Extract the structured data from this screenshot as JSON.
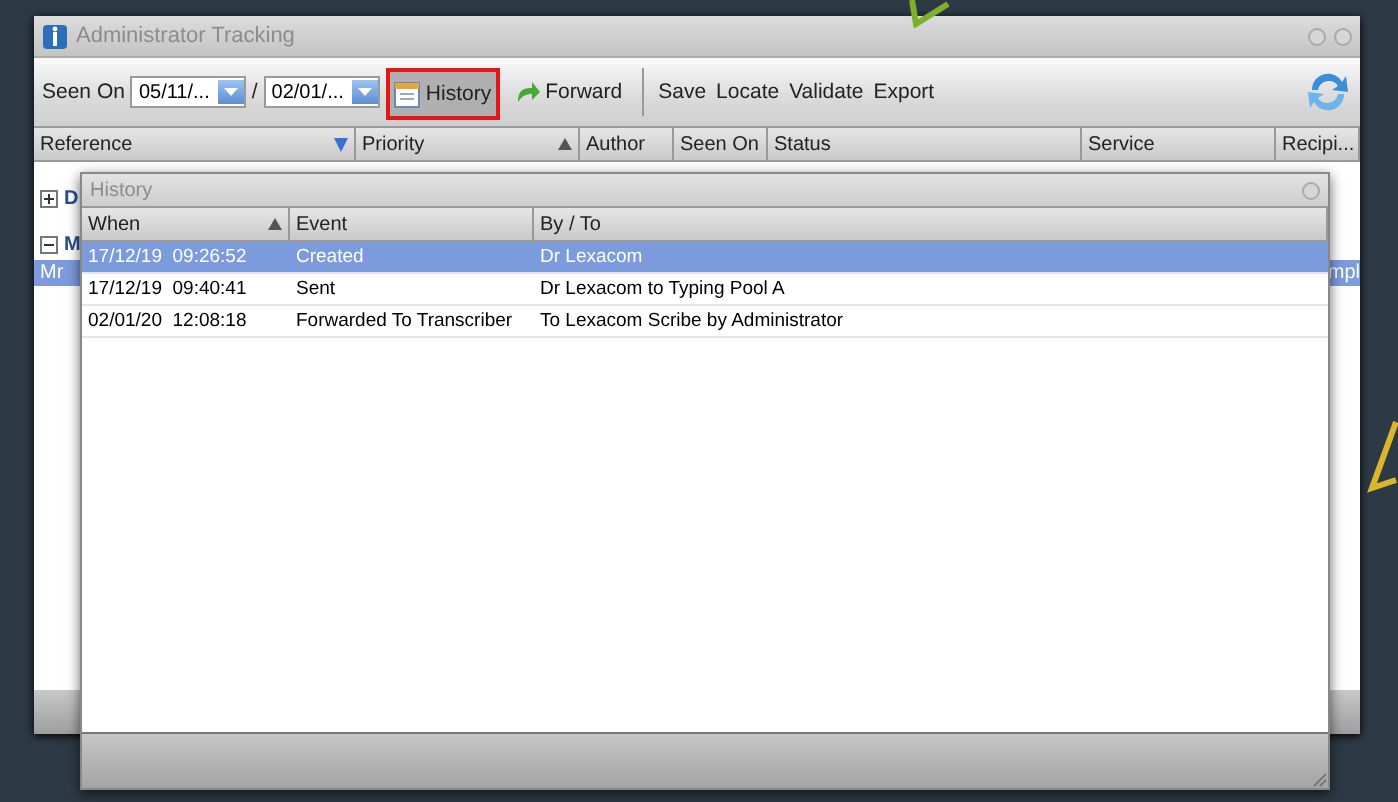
{
  "window": {
    "title": "Administrator Tracking"
  },
  "toolbar": {
    "seen_on_label": "Seen On",
    "date_from": "05/11/...",
    "date_separator": "/",
    "date_to": "02/01/...",
    "buttons": [
      {
        "label": "History",
        "kind": "history",
        "selected": true
      },
      {
        "label": "Forward",
        "kind": "forward",
        "selected": false
      }
    ],
    "actions": [
      "Save",
      "Locate",
      "Validate",
      "Export"
    ]
  },
  "table": {
    "columns": [
      {
        "label": "Reference",
        "sorted": false,
        "filtered": true
      },
      {
        "label": "Priority",
        "sorted": true,
        "filtered": false
      },
      {
        "label": "Author",
        "sorted": false,
        "filtered": false
      },
      {
        "label": "Seen On",
        "sorted": false,
        "filtered": false
      },
      {
        "label": "Status",
        "sorted": false,
        "filtered": false
      },
      {
        "label": "Service",
        "sorted": false,
        "filtered": false
      },
      {
        "label": "Recipi...",
        "sorted": false,
        "filtered": false
      }
    ],
    "groups": [
      {
        "label": "D",
        "expanded": false
      },
      {
        "label": "M",
        "expanded": true
      }
    ],
    "rows": [
      {
        "reference": "Mr",
        "recipient": "mpl",
        "selected": true
      }
    ]
  },
  "history": {
    "title": "History",
    "columns": [
      {
        "label": "When",
        "sorted": true,
        "filtered": false
      },
      {
        "label": "Event",
        "sorted": false,
        "filtered": false
      },
      {
        "label": "By / To",
        "sorted": false,
        "filtered": false
      }
    ],
    "rows": [
      {
        "when": "17/12/19  09:26:52",
        "event": "Created",
        "by_to": "Dr Lexacom",
        "selected": true
      },
      {
        "when": "17/12/19  09:40:41",
        "event": "Sent",
        "by_to": "Dr Lexacom to Typing Pool A",
        "selected": false
      },
      {
        "when": "02/01/20  12:08:18",
        "event": "Forwarded To Transcriber",
        "by_to": "To Lexacom Scribe by Administrator",
        "selected": false
      }
    ]
  }
}
